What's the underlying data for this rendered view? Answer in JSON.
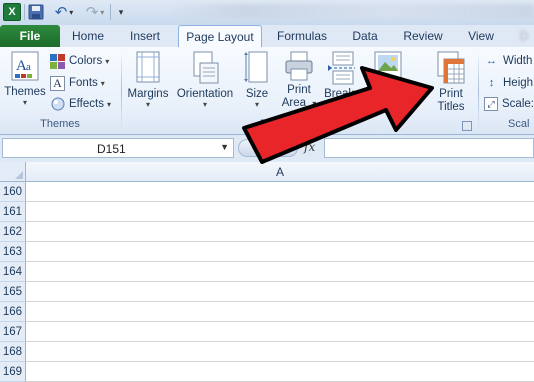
{
  "quick_access": {
    "app_icon_letter": "X",
    "items": [
      "excel-icon",
      "save-icon",
      "undo-icon",
      "redo-icon",
      "customize-icon"
    ]
  },
  "tabs": {
    "file": "File",
    "home": "Home",
    "insert": "Insert",
    "page_layout": "Page Layout",
    "formulas": "Formulas",
    "data": "Data",
    "review": "Review",
    "view": "View"
  },
  "ribbon": {
    "themes_group": {
      "label": "Themes",
      "themes_button": "Themes",
      "colors": "Colors",
      "fonts": "Fonts",
      "effects": "Effects"
    },
    "page_setup_group": {
      "label": "Page Se",
      "margins": "Margins",
      "orientation": "Orientation",
      "size": "Size",
      "print_area_line1": "Print",
      "print_area_line2": "Area",
      "breaks": "Breaks",
      "background_partial": "Ba",
      "print_titles_line1": "Print",
      "print_titles_line2": "Titles"
    },
    "scale_group": {
      "label": "Scal",
      "width": "Width",
      "height": "Heigh",
      "scale": "Scale:"
    }
  },
  "formula_bar": {
    "name_box_value": "D151",
    "fx_label": "fx",
    "formula_value": ""
  },
  "grid": {
    "columns": [
      "A"
    ],
    "rows": [
      "160",
      "161",
      "162",
      "163",
      "164",
      "165",
      "166",
      "167",
      "168",
      "169"
    ]
  },
  "colors": {
    "file_tab": "#1c6b2a",
    "ribbon_bg": "#e8f0fa",
    "arrow_fill": "#e8262a",
    "arrow_outline": "#000000"
  }
}
